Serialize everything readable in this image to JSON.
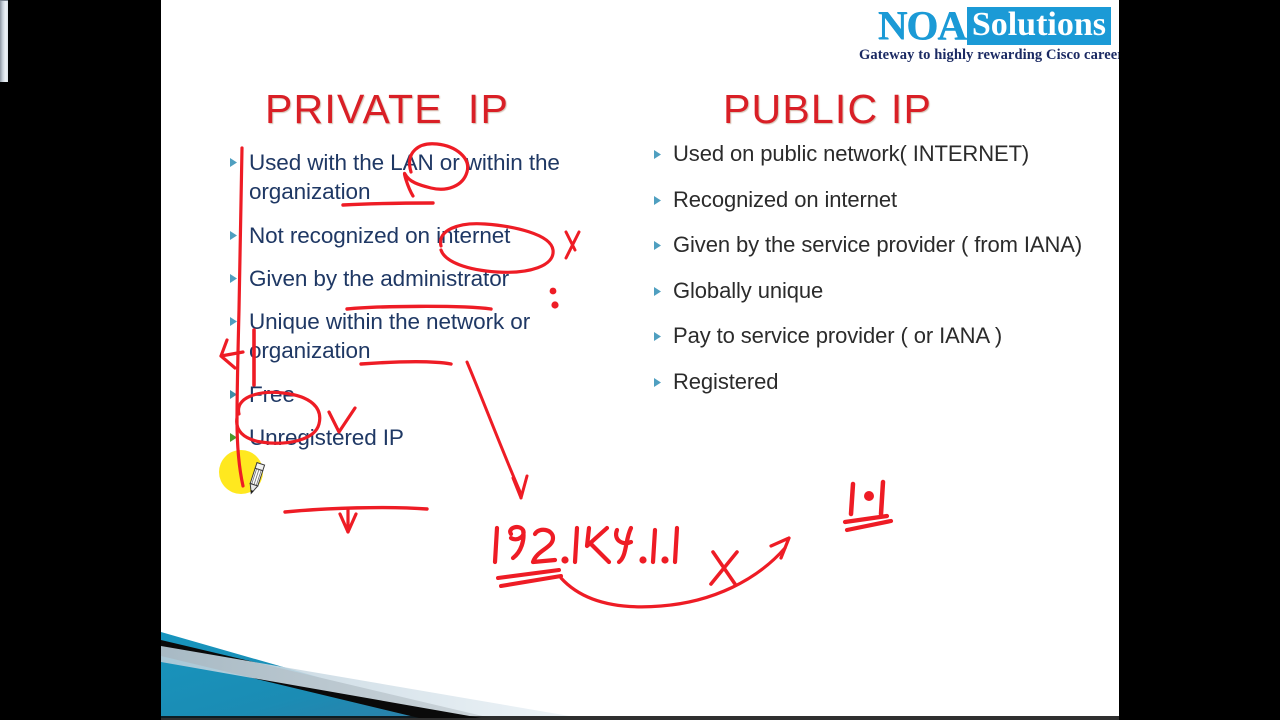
{
  "app": {
    "background_color": "#000000",
    "slide_background": "#ffffff"
  },
  "logo": {
    "name_primary": "NOA",
    "name_secondary": "Solutions",
    "tagline": "Gateway to  highly rewarding Cisco career",
    "primary_color": "#1b9ad6",
    "tagline_color": "#1b2a63"
  },
  "headings": {
    "left": "PRIVATE  IP",
    "right": "PUBLIC IP",
    "color": "#d91f26"
  },
  "columns": {
    "left": {
      "title": "PRIVATE  IP",
      "text_color": "#1f3864",
      "items": [
        "Used with the LAN or within the organization",
        "Not recognized on internet",
        "Given by the administrator",
        "Unique within the network or organization",
        "Free",
        "Unregistered IP"
      ]
    },
    "right": {
      "title": "PUBLIC IP",
      "text_color": "#2b2b2b",
      "items": [
        "Used on public network( INTERNET)",
        " Recognized on internet",
        "Given by the service provider ( from IANA)",
        "Globally unique",
        "Pay to service provider ( or IANA )",
        "Registered"
      ]
    }
  },
  "annotations": {
    "ink_color": "#ee1c25",
    "handwritten_ip": "192.168.1.1",
    "handwritten_mark": "1.1",
    "highlight_color": "#ffe713",
    "marks": [
      "circle-around-LAN",
      "underline-organization",
      "circle-around-on-internet",
      "check-mark-next-to-internet",
      "underline-administrator",
      "colon-dots-after-administrator",
      "underline-network",
      "vertical-bar-left-of-unique",
      "long-vertical-line-down-left-margin",
      "circle-around-free",
      "check-mark-next-to-free",
      "underline-under-unregistered-ip",
      "down-arrow-from-unregistered",
      "diagonal-arrow-to-ip-address",
      "underline-under-ip-address",
      "curved-arrow-with-x-crossing"
    ]
  },
  "decor": {
    "corner_teal": "#1a8fb5",
    "corner_dark": "#0b0b0b",
    "corner_pale": "#cfdde6"
  },
  "cursor": {
    "type": "pen-cursor"
  }
}
